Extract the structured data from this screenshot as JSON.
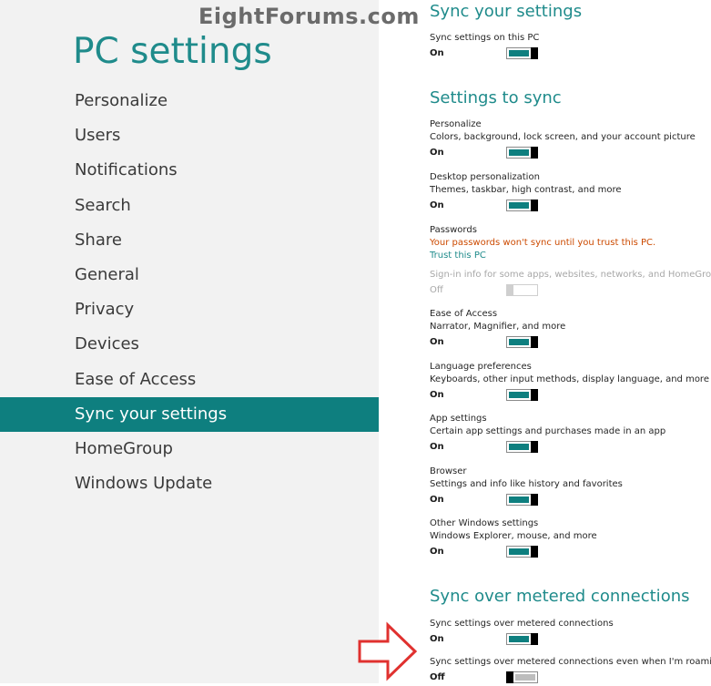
{
  "watermark": "EightForums.com",
  "sidebar": {
    "title": "PC settings",
    "items": [
      {
        "label": "Personalize"
      },
      {
        "label": "Users"
      },
      {
        "label": "Notifications"
      },
      {
        "label": "Search"
      },
      {
        "label": "Share"
      },
      {
        "label": "General"
      },
      {
        "label": "Privacy"
      },
      {
        "label": "Devices"
      },
      {
        "label": "Ease of Access"
      },
      {
        "label": "Sync your settings"
      },
      {
        "label": "HomeGroup"
      },
      {
        "label": "Windows Update"
      }
    ],
    "active_item": "Sync your settings"
  },
  "main": {
    "sync_header": "Sync your settings",
    "sync_pc": {
      "title": "Sync settings on this PC",
      "state": "On"
    },
    "settings_to_sync_header": "Settings to sync",
    "personalize": {
      "title": "Personalize",
      "desc": "Colors, background, lock screen, and your account picture",
      "state": "On"
    },
    "desktop": {
      "title": "Desktop personalization",
      "desc": "Themes, taskbar, high contrast, and more",
      "state": "On"
    },
    "passwords": {
      "title": "Passwords",
      "warning": "Your passwords won't sync until you trust this PC.",
      "link": "Trust this PC",
      "desc": "Sign-in info for some apps, websites, networks, and HomeGroup",
      "state": "Off"
    },
    "ease": {
      "title": "Ease of Access",
      "desc": "Narrator, Magnifier, and more",
      "state": "On"
    },
    "language": {
      "title": "Language preferences",
      "desc": "Keyboards, other input methods, display language, and more",
      "state": "On"
    },
    "app": {
      "title": "App settings",
      "desc": "Certain app settings and purchases made in an app",
      "state": "On"
    },
    "browser": {
      "title": "Browser",
      "desc": "Settings and info like history and favorites",
      "state": "On"
    },
    "other": {
      "title": "Other Windows settings",
      "desc": "Windows Explorer, mouse, and more",
      "state": "On"
    },
    "metered_header": "Sync over metered connections",
    "metered": {
      "title": "Sync settings over metered connections",
      "state": "On"
    },
    "roaming": {
      "title": "Sync settings over metered connections even when I'm roaming",
      "state": "Off"
    }
  },
  "colors": {
    "accent": "#0e7f7f",
    "header_text": "#1f8b8b",
    "warning": "#cc4a00",
    "arrow": "#e0312f"
  },
  "icons": {
    "annotation": "red-arrow-icon"
  }
}
